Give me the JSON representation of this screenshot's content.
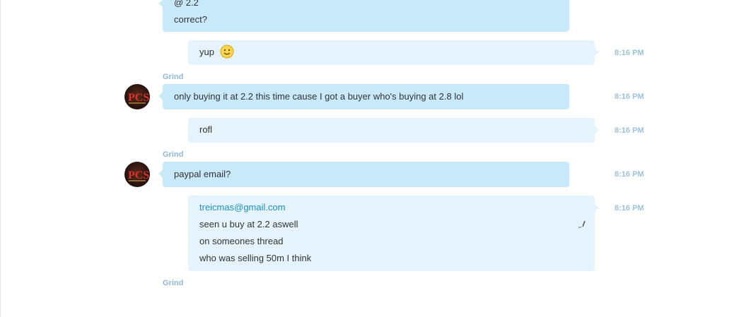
{
  "messages": [
    {
      "lines": [
        "@ 2.2",
        "correct?"
      ]
    },
    {
      "text": "yup",
      "emoji": "smiley-icon",
      "time": "8:16 PM"
    },
    {
      "sender": "Grind",
      "text": "only buying it at 2.2 this time cause I got a buyer who's buying at 2.8 lol",
      "time": "8:16 PM"
    },
    {
      "text": "rofl",
      "time": "8:16 PM"
    },
    {
      "sender": "Grind",
      "text": "paypal email?",
      "time": "8:16 PM"
    },
    {
      "lines": [
        "treicmas@gmail.com",
        "seen u buy at 2.2 aswell",
        "on someones thread",
        "who was selling 50m I think"
      ],
      "time": "8:16 PM",
      "edited_icon": "edited-pencil-icon"
    },
    {
      "sender": "Grind"
    }
  ],
  "colors": {
    "incoming_bubble": "#c7e9fa",
    "outgoing_bubble": "#e5f4fc",
    "timestamp": "#9cc2db",
    "sender_name": "#8fb8d4",
    "link": "#1a8fc9"
  }
}
